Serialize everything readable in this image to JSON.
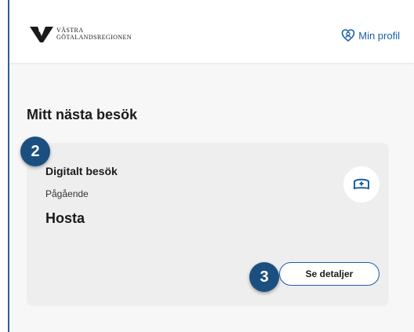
{
  "header": {
    "logo_line1": "VÄSTRA",
    "logo_line2": "GÖTALANDSREGIONEN",
    "profile_label": "Min profil"
  },
  "main": {
    "section_title": "Mitt nästa besök",
    "visit": {
      "type": "Digitalt besök",
      "status": "Pågående",
      "title": "Hosta",
      "details_button": "Se detaljer"
    }
  },
  "annotations": {
    "step_2": "2",
    "step_3": "3"
  },
  "colors": {
    "accent": "#1a5ea8",
    "badge": "#1b4f80",
    "frame_border": "#2f5f9e"
  },
  "icons": {
    "profile": "person-heart-icon",
    "visit": "nurse-cap-icon"
  }
}
